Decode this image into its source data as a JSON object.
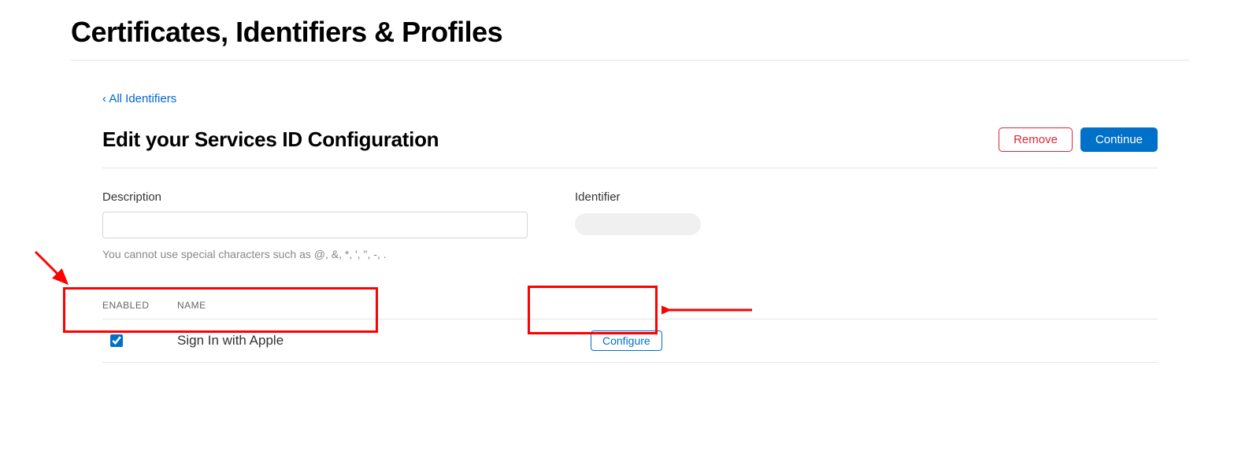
{
  "page": {
    "title": "Certificates, Identifiers & Profiles"
  },
  "nav": {
    "back_link": "‹ All Identifiers"
  },
  "header": {
    "section_title": "Edit your Services ID Configuration",
    "remove_label": "Remove",
    "continue_label": "Continue"
  },
  "form": {
    "description_label": "Description",
    "description_value": "",
    "identifier_label": "Identifier",
    "helper_text": "You cannot use special characters such as @, &, *, ', \", -, ."
  },
  "table": {
    "header_enabled": "ENABLED",
    "header_name": "NAME",
    "rows": [
      {
        "enabled": true,
        "name": "Sign In with Apple",
        "configure_label": "Configure"
      }
    ]
  }
}
